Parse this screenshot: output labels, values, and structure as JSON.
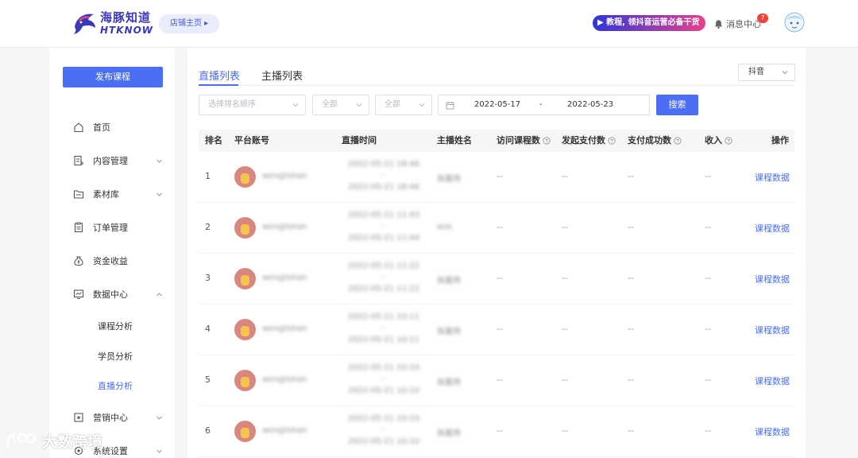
{
  "header": {
    "logo_cn": "海豚知道",
    "logo_en": "HTKNOW",
    "store_home": "店铺主页 ▸",
    "promo": "▶ 教程, 领抖音运营必备干货",
    "messages_label": "消息中心",
    "messages_count": "7"
  },
  "sidebar": {
    "publish_button": "发布课程",
    "items": [
      {
        "label": "首页",
        "icon": "home-icon"
      },
      {
        "label": "内容管理",
        "icon": "content-icon"
      },
      {
        "label": "素材库",
        "icon": "folder-icon"
      },
      {
        "label": "订单管理",
        "icon": "order-icon"
      },
      {
        "label": "资金收益",
        "icon": "money-bag-icon"
      },
      {
        "label": "数据中心",
        "icon": "data-center-icon"
      },
      {
        "label": "营销中心",
        "icon": "marketing-icon"
      },
      {
        "label": "系统设置",
        "icon": "settings-icon"
      }
    ],
    "data_center_sub": [
      "课程分析",
      "学员分析",
      "直播分析"
    ],
    "active_sub": "直播分析"
  },
  "main": {
    "tabs": [
      "直播列表",
      "主播列表"
    ],
    "active_tab": "直播列表",
    "platform": "抖音",
    "filters": {
      "rank_order_placeholder": "选择排名顺序",
      "filter2": "全部",
      "filter3": "全部",
      "date_start": "2022-05-17",
      "date_separator": "-",
      "date_end": "2022-05-23",
      "search_button": "搜索"
    },
    "columns": [
      "排名",
      "平台账号",
      "直播时间",
      "主播姓名",
      "访问课程数",
      "发起支付数",
      "支付成功数",
      "收入",
      "操作"
    ],
    "rows": [
      {
        "rank": "1",
        "account": "wenglishan",
        "start": "2022-05-21 18:46",
        "sep": "-",
        "end": "2022-05-21 18:46",
        "anchor": "张嘉伟",
        "visits": "--",
        "pay_init": "--",
        "pay_ok": "--",
        "income": "--",
        "action": "课程数据"
      },
      {
        "rank": "2",
        "account": "wenglishan",
        "start": "2022-05-21 11:43",
        "sep": "-",
        "end": "2022-05-21 11:44",
        "anchor": "wss",
        "visits": "--",
        "pay_init": "--",
        "pay_ok": "--",
        "income": "--",
        "action": "课程数据"
      },
      {
        "rank": "3",
        "account": "wenglishan",
        "start": "2022-05-21 11:22",
        "sep": "-",
        "end": "2022-05-21 11:22",
        "anchor": "张嘉伟",
        "visits": "--",
        "pay_init": "--",
        "pay_ok": "--",
        "income": "--",
        "action": "课程数据"
      },
      {
        "rank": "4",
        "account": "wenglishan",
        "start": "2022-05-21 10:11",
        "sep": "-",
        "end": "2022-05-21 10:11",
        "anchor": "张嘉伟",
        "visits": "--",
        "pay_init": "--",
        "pay_ok": "--",
        "income": "--",
        "action": "课程数据"
      },
      {
        "rank": "5",
        "account": "wenglishan",
        "start": "2022-05-21 10:10",
        "sep": "-",
        "end": "2022-05-21 10:10",
        "anchor": "张嘉伟",
        "visits": "--",
        "pay_init": "--",
        "pay_ok": "--",
        "income": "--",
        "action": "课程数据"
      },
      {
        "rank": "6",
        "account": "wenglishan",
        "start": "2022-05-21 10:10",
        "sep": "-",
        "end": "2022-05-21 10:10",
        "anchor": "张嘉伟",
        "visits": "--",
        "pay_init": "--",
        "pay_ok": "--",
        "income": "--",
        "action": "课程数据"
      }
    ]
  },
  "watermark": "大数跨境",
  "colors": {
    "accent": "#4c6ef5",
    "badge": "#f0433a",
    "brand": "#3b39b8"
  }
}
